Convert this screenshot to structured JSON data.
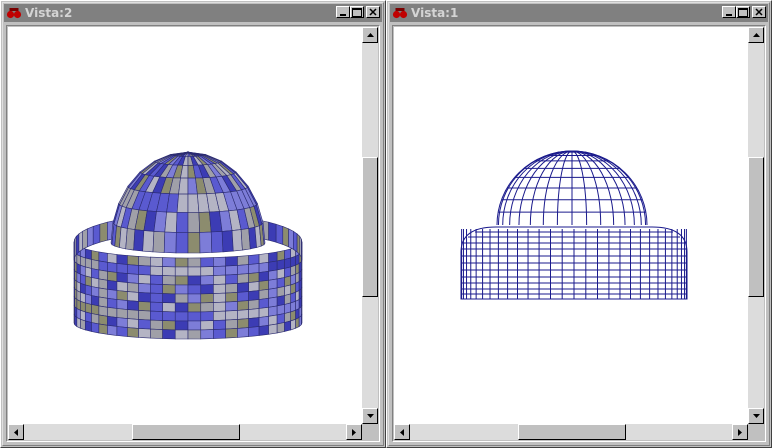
{
  "windows": [
    {
      "title": "Vista:2",
      "render_mode": "shaded"
    },
    {
      "title": "Vista:1",
      "render_mode": "wireframe"
    }
  ],
  "colors": {
    "title_bar_inactive": "#808080",
    "face": "#c0c0c0",
    "mesh_blue": "#1a1a8c",
    "shade_blue": "#5a5ad0",
    "shade_gray": "#a0a0a8",
    "shade_olive": "#8c8c6e"
  },
  "icons": [
    "app-icon",
    "minimize-icon",
    "maximize-icon",
    "close-icon",
    "arrow-up-icon",
    "arrow-down-icon",
    "arrow-left-icon",
    "arrow-right-icon"
  ]
}
